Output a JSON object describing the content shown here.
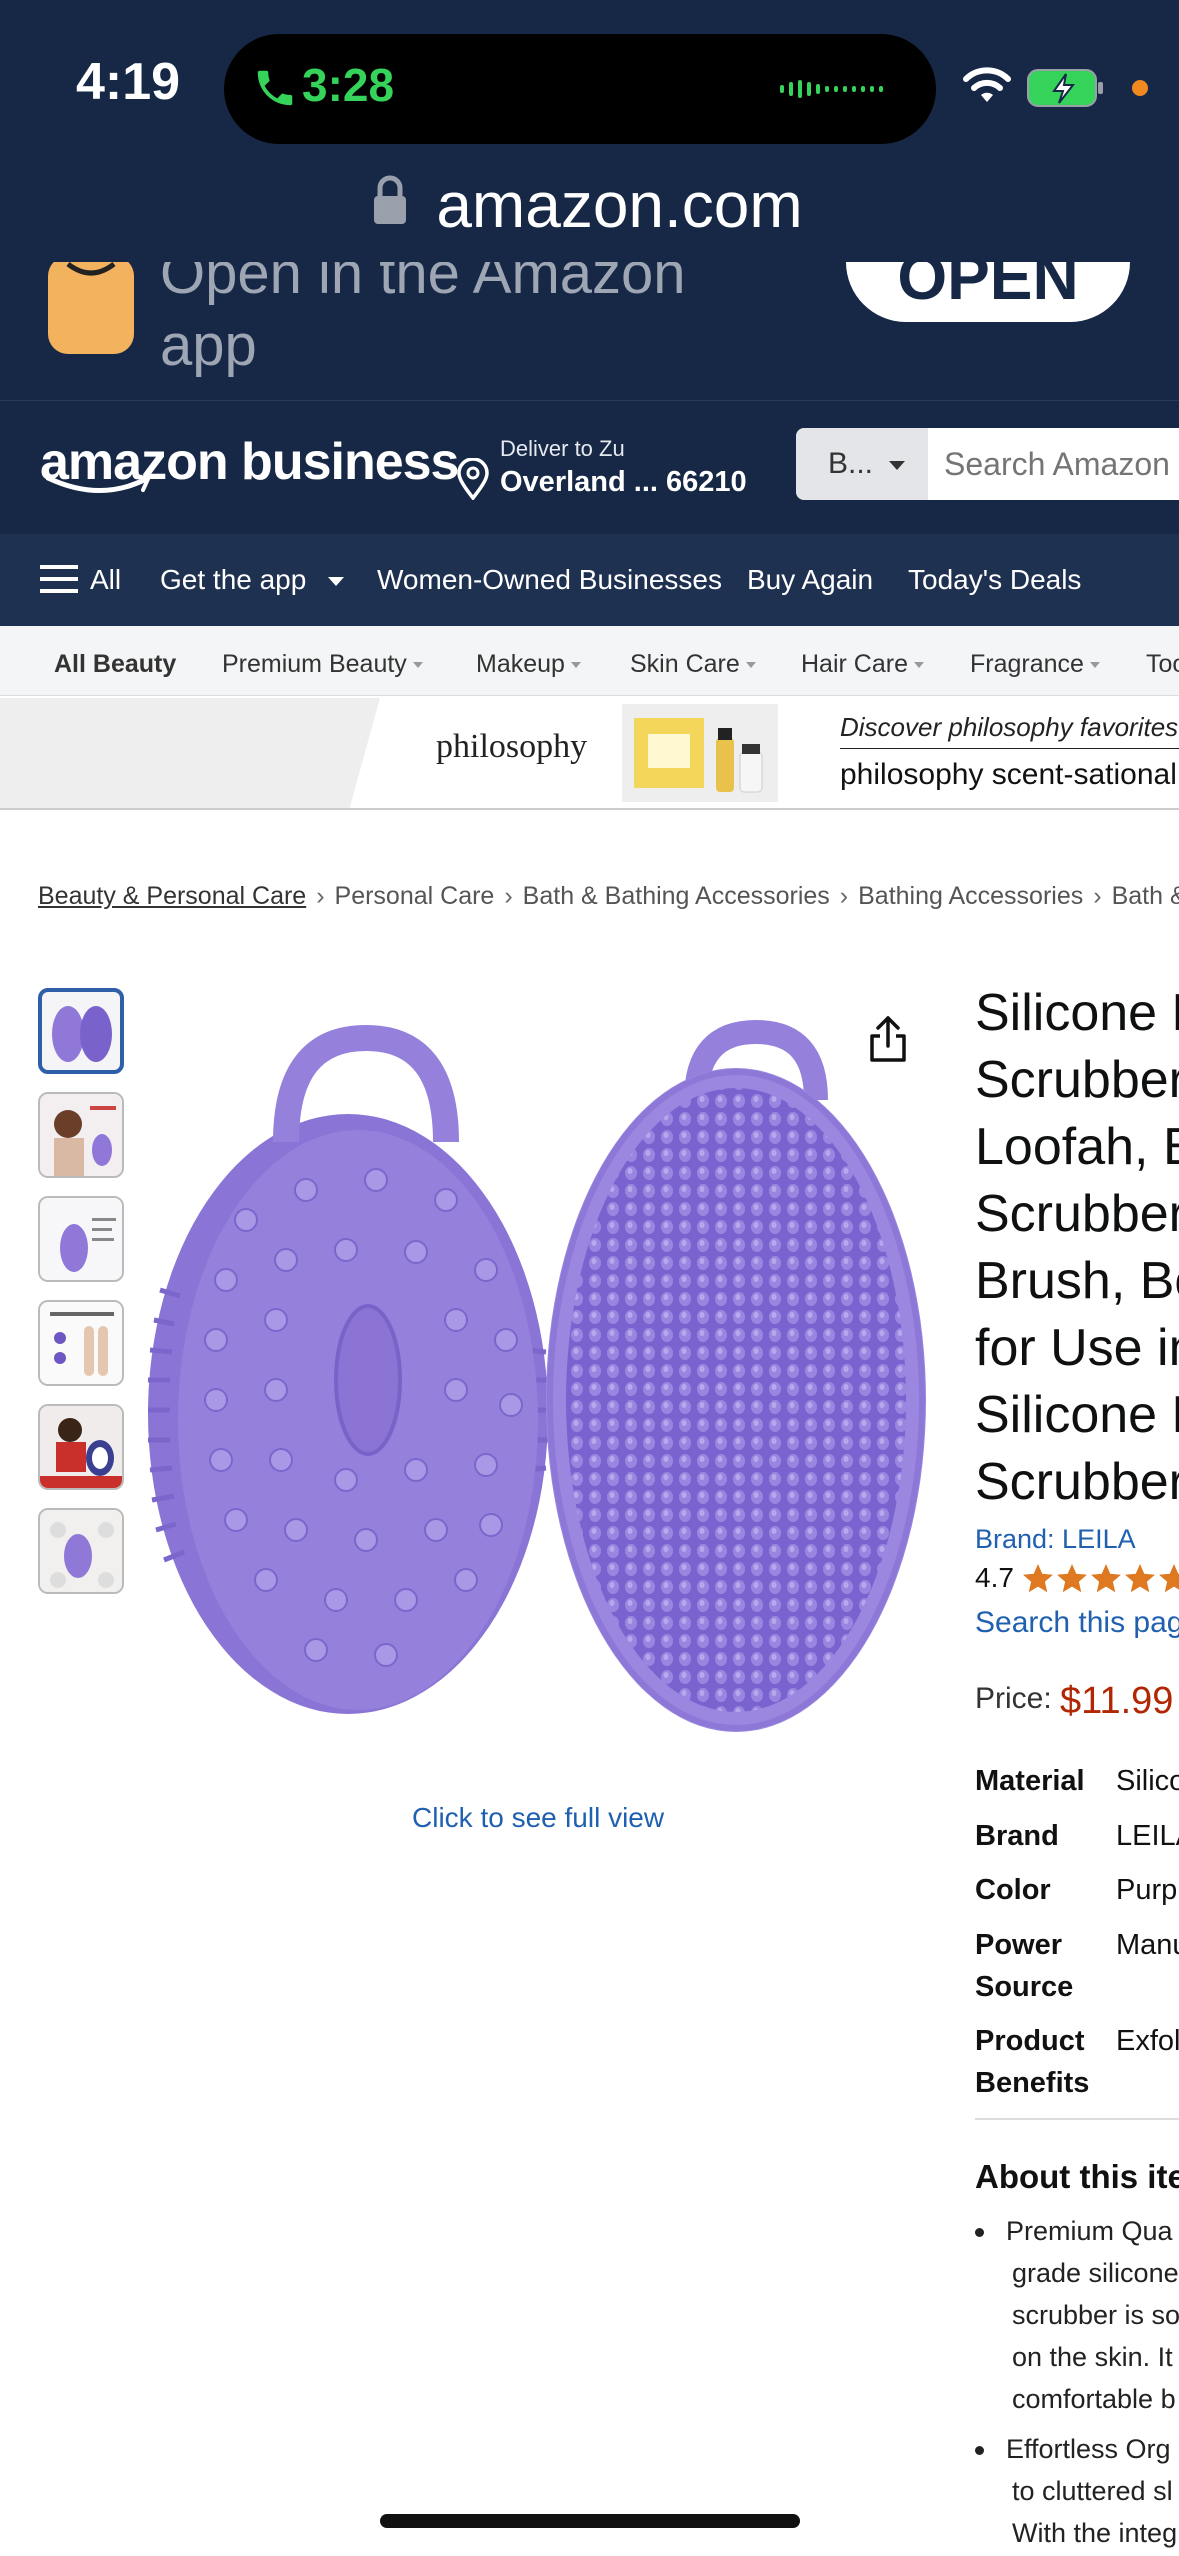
{
  "status_bar": {
    "time": "4:19",
    "call_time": "3:28"
  },
  "browser": {
    "url": "amazon.com"
  },
  "open_app_banner": {
    "text": "Open in the Amazon app",
    "button": "OPEN"
  },
  "header": {
    "logo": "amazon business",
    "deliver_line1": "Deliver to Zu",
    "deliver_line2": "Overland ... 66210",
    "search_category": "B...",
    "search_placeholder": "Search Amazon Business"
  },
  "nav": {
    "all": "All",
    "items": [
      "Get the app",
      "Women-Owned Businesses",
      "Buy Again",
      "Today's Deals"
    ]
  },
  "subnav": {
    "items": [
      "All Beauty",
      "Premium Beauty",
      "Makeup",
      "Skin Care",
      "Hair Care",
      "Fragrance",
      "Too"
    ]
  },
  "ad": {
    "brand": "philosophy",
    "headline": "Discover philosophy favorites",
    "subline": "philosophy scent-sational"
  },
  "breadcrumbs": [
    "Beauty & Personal Care",
    "Personal Care",
    "Bath & Bathing Accessories",
    "Bathing Accessories",
    "Bath &"
  ],
  "gallery": {
    "thumbnails": [
      "thumb-1",
      "thumb-2",
      "thumb-3",
      "thumb-4",
      "thumb-5",
      "thumb-6"
    ],
    "full_view": "Click to see full view",
    "colors": {
      "purple": "#8f78d8",
      "purple_dark": "#6e57c2"
    }
  },
  "product": {
    "title_lines": [
      "Silicone B",
      "Scrubber,",
      "Loofah, B",
      "Scrubber,",
      "Brush, Bo",
      "for Use in",
      "Silicone L",
      "Scrubber"
    ],
    "brand": "Brand: LEILA",
    "rating": "4.7",
    "rating_value": 4.7,
    "search_page": "Search this pag",
    "price_label": "Price:",
    "price": "$11.99",
    "specs": [
      {
        "key": "Material",
        "value": "Silico"
      },
      {
        "key": "Brand",
        "value": "LEILA"
      },
      {
        "key": "Color",
        "value": "Purp"
      },
      {
        "key": "Power Source",
        "value": "Manu"
      },
      {
        "key": "Product Benefits",
        "value": "Exfol"
      }
    ],
    "about_heading": "About this ite",
    "bullets": [
      [
        "Premium Qua",
        "grade silicone",
        "scrubber is so",
        "on the skin. It",
        "comfortable b"
      ],
      [
        "Effortless Org",
        "to cluttered sl",
        "With the integ"
      ]
    ]
  }
}
